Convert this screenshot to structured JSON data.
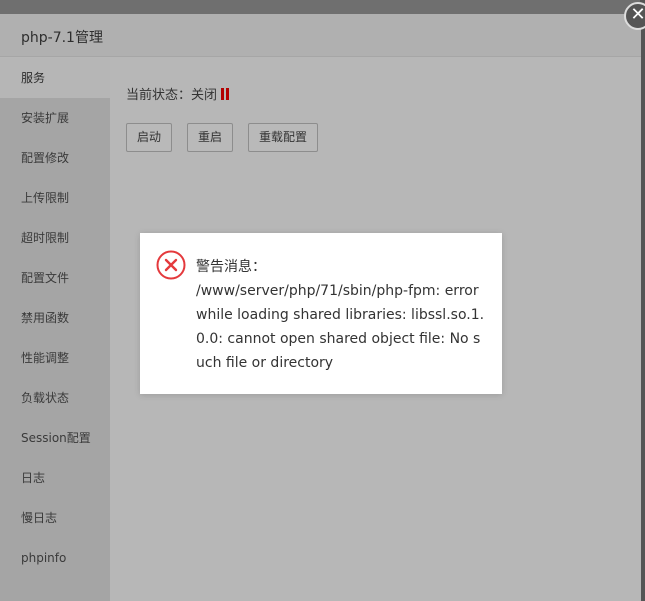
{
  "window": {
    "title": "php-7.1管理",
    "close_glyph": "✕"
  },
  "sidebar": {
    "items": [
      {
        "label": "服务",
        "active": true
      },
      {
        "label": "安装扩展"
      },
      {
        "label": "配置修改"
      },
      {
        "label": "上传限制"
      },
      {
        "label": "超时限制"
      },
      {
        "label": "配置文件"
      },
      {
        "label": "禁用函数"
      },
      {
        "label": "性能调整"
      },
      {
        "label": "负载状态"
      },
      {
        "label": "Session配置"
      },
      {
        "label": "日志"
      },
      {
        "label": "慢日志"
      },
      {
        "label": "phpinfo"
      }
    ]
  },
  "service": {
    "status_label": "当前状态：关闭",
    "status_icon": "pause-icon",
    "status_color": "#b30000",
    "buttons": {
      "start": "启动",
      "restart": "重启",
      "reload": "重载配置"
    }
  },
  "alert": {
    "icon": "error-circle-icon",
    "icon_color": "#e4393c",
    "title": "警告消息：",
    "message": "/www/server/php/71/sbin/php-fpm: error while loading shared libraries: libssl.so.1.0.0: cannot open shared object file: No such file or directory"
  }
}
